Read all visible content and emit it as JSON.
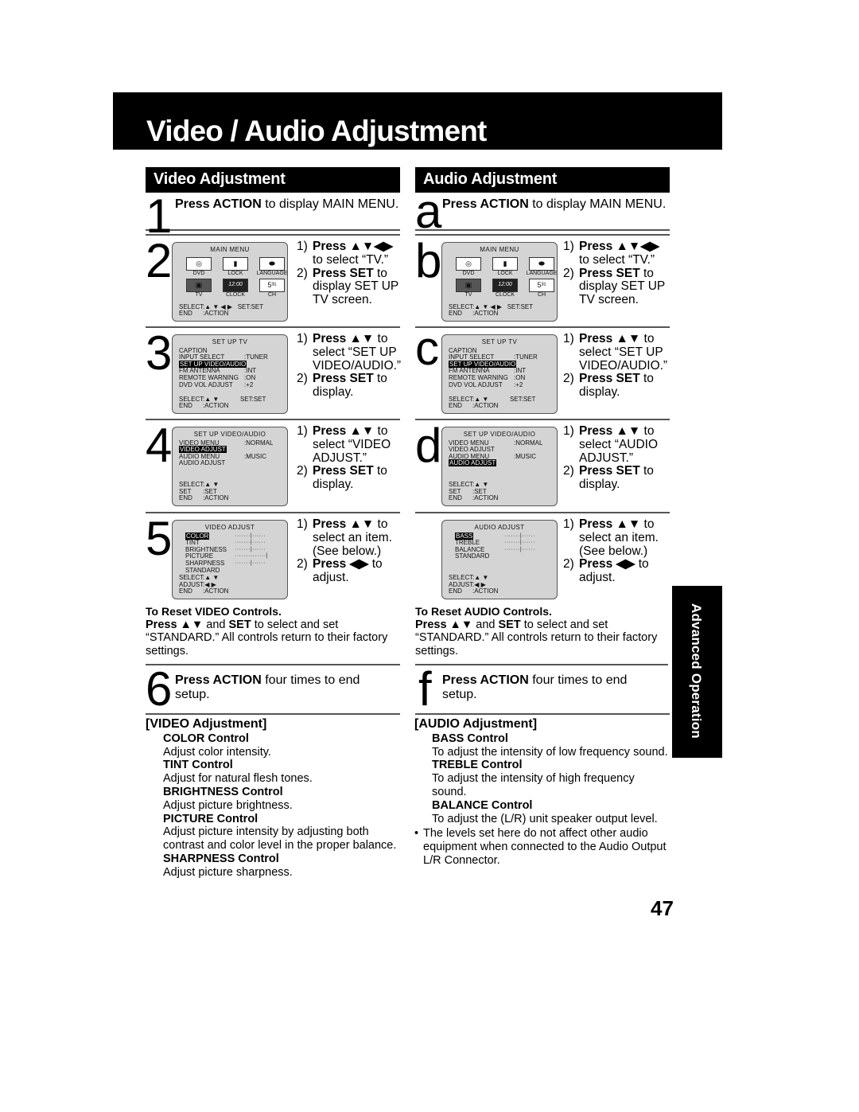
{
  "title": "Video / Audio Adjustment",
  "side_tab": "Advanced Operation",
  "page_number": "47",
  "glyphs": {
    "up_down": "▲▼",
    "all_arrows": "▲▼◀▶",
    "left_right": "◀▶"
  },
  "video": {
    "header": "Video Adjustment",
    "step1": {
      "num": "1",
      "bold": "Press ACTION",
      "text": " to display MAIN MENU."
    },
    "steps": [
      {
        "num": "2",
        "screen": "main_menu",
        "instructions": [
          {
            "n": "1)",
            "bold": "Press ▲▼◀▶",
            "text": " to select “TV.”"
          },
          {
            "n": "2)",
            "bold": "Press SET",
            "text": " to display SET UP TV screen."
          }
        ]
      },
      {
        "num": "3",
        "screen": "setup_tv",
        "instructions": [
          {
            "n": "1)",
            "bold": "Press ▲▼",
            "text": " to select “SET UP VIDEO/AUDIO.”"
          },
          {
            "n": "2)",
            "bold": "Press SET",
            "text": " to display."
          }
        ]
      },
      {
        "num": "4",
        "screen": "setup_va",
        "instructions": [
          {
            "n": "1)",
            "bold": "Press ▲▼",
            "text": " to select “VIDEO ADJUST.”"
          },
          {
            "n": "2)",
            "bold": "Press SET",
            "text": " to display."
          }
        ]
      },
      {
        "num": "5",
        "screen": "video_adjust",
        "instructions": [
          {
            "n": "1)",
            "bold": "Press ▲▼",
            "text": " to select an item. (See below.)"
          },
          {
            "n": "2)",
            "bold": "Press ◀▶",
            "text": " to adjust."
          }
        ]
      }
    ],
    "reset": {
      "heading": "To Reset VIDEO Controls.",
      "press": "Press ▲▼",
      "and": " and ",
      "set": "SET",
      "rest": " to select and set “STANDARD.” All controls return to their factory settings."
    },
    "final_step": {
      "num": "6",
      "bold": "Press ACTION",
      "text": " four times to end setup."
    },
    "descriptions": {
      "heading": "[VIDEO Adjustment]",
      "items": [
        {
          "name": "COLOR Control",
          "text": "Adjust color intensity."
        },
        {
          "name": "TINT Control",
          "text": "Adjust for natural flesh tones."
        },
        {
          "name": "BRIGHTNESS Control",
          "text": "Adjust picture brightness."
        },
        {
          "name": "PICTURE Control",
          "text": "Adjust picture intensity by adjusting both contrast and color level in the proper balance."
        },
        {
          "name": "SHARPNESS Control",
          "text": "Adjust picture sharpness."
        }
      ]
    }
  },
  "audio": {
    "header": "Audio Adjustment",
    "step1": {
      "num": "a",
      "bold": "Press ACTION",
      "text": " to display MAIN MENU."
    },
    "steps": [
      {
        "num": "b",
        "instructions": [
          {
            "n": "1)",
            "bold": "Press ▲▼◀▶",
            "text": " to select “TV.”"
          },
          {
            "n": "2)",
            "bold": "Press SET",
            "text": " to display SET UP TV screen."
          }
        ]
      },
      {
        "num": "c",
        "instructions": [
          {
            "n": "1)",
            "bold": "Press ▲▼",
            "text": " to select “SET UP VIDEO/AUDIO.”"
          },
          {
            "n": "2)",
            "bold": "Press SET",
            "text": " to display."
          }
        ]
      },
      {
        "num": "d",
        "instructions": [
          {
            "n": "1)",
            "bold": "Press ▲▼",
            "text": " to select “AUDIO ADJUST.”"
          },
          {
            "n": "2)",
            "bold": "Press SET",
            "text": " to display."
          }
        ]
      },
      {
        "num": "",
        "instructions": [
          {
            "n": "1)",
            "bold": "Press ▲▼",
            "text": " to select an item. (See below.)"
          },
          {
            "n": "2)",
            "bold": "Press ◀▶",
            "text": " to adjust."
          }
        ]
      }
    ],
    "reset": {
      "heading": "To Reset AUDIO Controls.",
      "press": "Press ▲▼",
      "and": " and ",
      "set": "SET",
      "rest": " to select and set “STANDARD.” All controls return to their factory settings."
    },
    "final_step": {
      "num": "f",
      "bold": "Press ACTION",
      "text": " four times to end setup."
    },
    "descriptions": {
      "heading": "[AUDIO Adjustment]",
      "items": [
        {
          "name": "BASS Control",
          "text": "To adjust the intensity of low frequency sound."
        },
        {
          "name": "TREBLE Control",
          "text": "To adjust the intensity of high frequency sound."
        },
        {
          "name": "BALANCE Control",
          "text": "To adjust the (L/R) unit speaker output level."
        }
      ],
      "note": "The levels set here do not affect other audio equipment when connected to the Audio Output L/R Connector."
    }
  },
  "screens": {
    "main_menu": {
      "title": "MAIN MENU",
      "items": [
        {
          "label": "DVD",
          "icon": "disc-icon",
          "glyph": "◎",
          "selected": false
        },
        {
          "label": "LOCK",
          "icon": "lock-icon",
          "glyph": "▮",
          "selected": false
        },
        {
          "label": "LANGUAGE",
          "icon": "lips-icon",
          "glyph": "⬬",
          "selected": false
        },
        {
          "label": "TV",
          "icon": "tv-icon",
          "glyph": "▣",
          "selected": true
        },
        {
          "label": "CLOCK",
          "icon": "clock-icon",
          "glyph": "12:00",
          "selected": false
        },
        {
          "label": "CH",
          "icon": "channel-icon",
          "glyph": "5³¹",
          "selected": false
        }
      ],
      "footer": [
        {
          "k": "SELECT",
          "v": ":▲ ▼ ◀ ▶   SET:SET"
        },
        {
          "k": "END",
          "v": ":ACTION"
        }
      ]
    },
    "setup_tv": {
      "title": "SET UP TV",
      "lines": [
        {
          "k": "CAPTION",
          "v": "",
          "hl": false
        },
        {
          "k": "INPUT SELECT",
          "v": ":TUNER",
          "hl": false
        },
        {
          "k": "SET UP VIDEO/AUDIO",
          "v": "",
          "hl": true
        },
        {
          "k": "FM ANTENNA",
          "v": ":INT",
          "hl": false
        },
        {
          "k": "REMOTE WARNING",
          "v": ":ON",
          "hl": false
        },
        {
          "k": "DVD VOL ADJUST",
          "v": ":+2",
          "hl": false
        }
      ],
      "footer": [
        {
          "k": "SELECT",
          "v": ":▲ ▼            SET:SET"
        },
        {
          "k": "END",
          "v": ":ACTION"
        }
      ]
    },
    "setup_va_video": {
      "title": "SET UP VIDEO/AUDIO",
      "lines": [
        {
          "k": "VIDEO MENU",
          "v": ":NORMAL",
          "hl": false
        },
        {
          "k": "VIDEO ADJUST",
          "v": "",
          "hl": true
        },
        {
          "k": "AUDIO MENU",
          "v": ":MUSIC",
          "hl": false
        },
        {
          "k": "AUDIO ADJUST",
          "v": "",
          "hl": false
        }
      ],
      "footer": [
        {
          "k": "SELECT",
          "v": ":▲ ▼"
        },
        {
          "k": "SET",
          "v": ":SET"
        },
        {
          "k": "END",
          "v": ":ACTION"
        }
      ]
    },
    "setup_va_audio": {
      "title": "SET UP VIDEO/AUDIO",
      "lines": [
        {
          "k": "VIDEO MENU",
          "v": ":NORMAL",
          "hl": false
        },
        {
          "k": "VIDEO ADJUST",
          "v": "",
          "hl": false
        },
        {
          "k": "AUDIO MENU",
          "v": ":MUSIC",
          "hl": false
        },
        {
          "k": "AUDIO ADJUST",
          "v": "",
          "hl": true
        }
      ],
      "footer": [
        {
          "k": "SELECT",
          "v": ":▲ ▼"
        },
        {
          "k": "SET",
          "v": ":SET"
        },
        {
          "k": "END",
          "v": ":ACTION"
        }
      ]
    },
    "video_adjust": {
      "title": "VIDEO ADJUST",
      "lines": [
        {
          "k": "COLOR",
          "v": "·······|······",
          "hl": true
        },
        {
          "k": "TINT",
          "v": "·······|······",
          "hl": false
        },
        {
          "k": "BRIGHTNESS",
          "v": "·······|······",
          "hl": false
        },
        {
          "k": "PICTURE",
          "v": "··············|",
          "hl": false
        },
        {
          "k": "SHARPNESS",
          "v": "·······|······",
          "hl": false
        },
        {
          "k": "STANDARD",
          "v": "",
          "hl": false
        }
      ],
      "footer": [
        {
          "k": "SELECT",
          "v": ":▲ ▼"
        },
        {
          "k": "ADJUST",
          "v": ":◀ ▶"
        },
        {
          "k": "END",
          "v": ":ACTION"
        }
      ]
    },
    "audio_adjust": {
      "title": "AUDIO ADJUST",
      "lines": [
        {
          "k": "BASS",
          "v": "·······|······",
          "hl": true
        },
        {
          "k": "TREBLE",
          "v": "·······|······",
          "hl": false
        },
        {
          "k": "BALANCE",
          "v": "·······|······",
          "hl": false
        },
        {
          "k": "STANDARD",
          "v": "",
          "hl": false
        }
      ],
      "footer": [
        {
          "k": "SELECT",
          "v": ":▲ ▼"
        },
        {
          "k": "ADJUST",
          "v": ":◀ ▶"
        },
        {
          "k": "END",
          "v": ":ACTION"
        }
      ]
    }
  }
}
